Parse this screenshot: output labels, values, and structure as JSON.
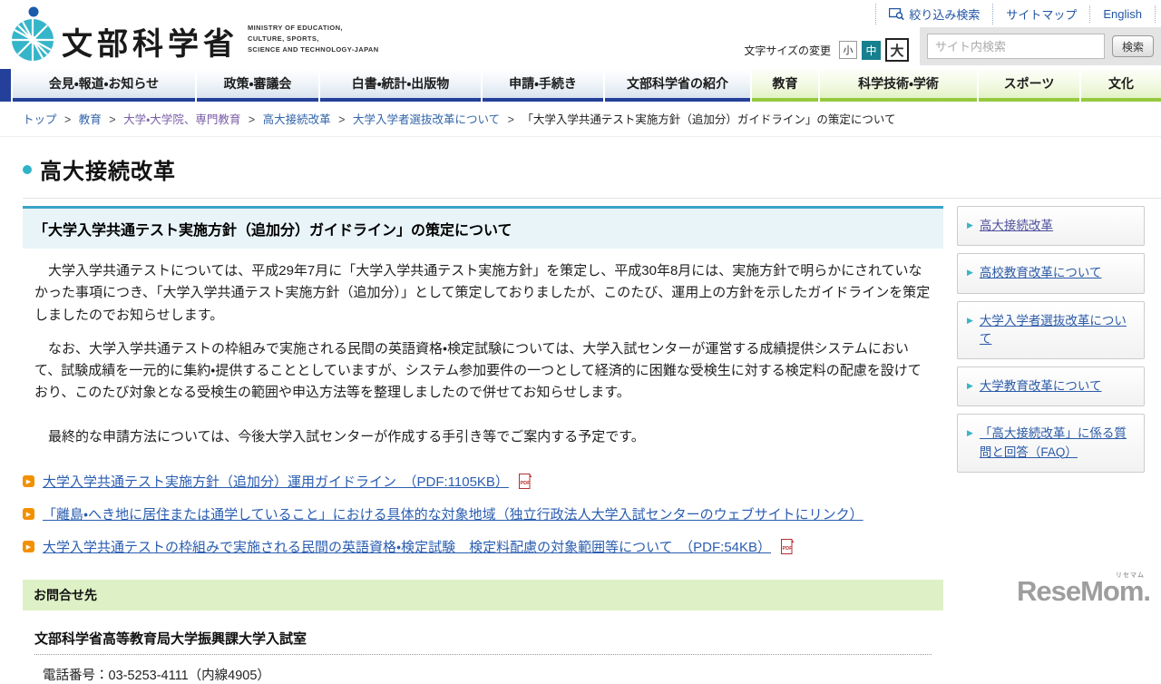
{
  "header": {
    "logo": {
      "title": "文部科学省",
      "subtitle_lines": [
        "MINISTRY OF EDUCATION,",
        "CULTURE, SPORTS,",
        "SCIENCE AND TECHNOLOGY-JAPAN"
      ]
    },
    "utility_links": [
      {
        "label": "絞り込み検索",
        "icon": "filter-search-icon"
      },
      {
        "label": "サイトマップ"
      },
      {
        "label": "English"
      }
    ],
    "font_size": {
      "label": "文字サイズの変更",
      "options": [
        {
          "label": "小",
          "selected": false
        },
        {
          "label": "中",
          "selected": true
        },
        {
          "label": "大",
          "selected": false
        }
      ]
    },
    "search": {
      "placeholder": "サイト内検索",
      "button_label": "検索"
    }
  },
  "nav": {
    "items": [
      {
        "label": "会見・報道・お知らせ",
        "theme": "blue"
      },
      {
        "label": "政策・審議会",
        "theme": "blue"
      },
      {
        "label": "白書・統計・出版物",
        "theme": "blue"
      },
      {
        "label": "申請・手続き",
        "theme": "blue"
      },
      {
        "label": "文部科学省の紹介",
        "theme": "blue"
      },
      {
        "label": "教育",
        "theme": "green"
      },
      {
        "label": "科学技術・学術",
        "theme": "green"
      },
      {
        "label": "スポーツ",
        "theme": "green"
      },
      {
        "label": "文化",
        "theme": "green"
      }
    ]
  },
  "breadcrumb": {
    "separator": ">",
    "items": [
      {
        "label": "トップ",
        "type": "link"
      },
      {
        "label": "教育",
        "type": "link"
      },
      {
        "label": "大学・大学院、専門教育",
        "type": "visited"
      },
      {
        "label": "高大接続改革",
        "type": "link"
      },
      {
        "label": "大学入学者選抜改革について",
        "type": "link"
      },
      {
        "label": "「大学入学共通テスト実施方針（追加分）ガイドライン」の策定について",
        "type": "current"
      }
    ]
  },
  "page": {
    "section_title": "高大接続改革"
  },
  "main": {
    "article_title": "「大学入学共通テスト実施方針（追加分）ガイドライン」の策定について",
    "paragraphs": [
      "　大学入学共通テストについては、平成29年7月に「大学入学共通テスト実施方針」を策定し、平成30年8月には、実施方針で明らかにされていなかった事項につき、「大学入学共通テスト実施方針（追加分）」として策定しておりましたが、このたび、運用上の方針を示したガイドラインを策定しましたのでお知らせします。",
      "　なお、大学入学共通テストの枠組みで実施される民間の英語資格・検定試験については、大学入試センターが運営する成績提供システムにおいて、試験成績を一元的に集約・提供することとしていますが、システム参加要件の一つとして経済的に困難な受検生に対する検定料の配慮を設けており、このたび対象となる受検生の範囲や申込方法等を整理しましたので併せてお知らせします。",
      "　最終的な申請方法については、今後大学入試センターが作成する手引き等でご案内する予定です。"
    ],
    "links": [
      {
        "label": "大学入学共通テスト実施方針（追加分）運用ガイドライン　（PDF:1105KB）",
        "pdf": true
      },
      {
        "label": "「離島・へき地に居住または通学していること」における具体的な対象地域（独立行政法人大学入試センターのウェブサイトにリンク）",
        "pdf": false
      },
      {
        "label": "大学入学共通テストの枠組みで実施される民間の英語資格・検定試験　検定料配慮の対象範囲等について　（PDF:54KB）",
        "pdf": true
      }
    ],
    "contact": {
      "heading": "お問合せ先",
      "department": "文部科学省高等教育局大学振興課大学入試室",
      "phone": "電話番号：03-5253-4111（内線4905）"
    }
  },
  "sidebar": {
    "items": [
      {
        "label": "高大接続改革",
        "visited": true
      },
      {
        "label": "高校教育改革について",
        "visited": false
      },
      {
        "label": "大学入学者選抜改革について",
        "visited": false
      },
      {
        "label": "大学教育改革について",
        "visited": false
      },
      {
        "label": "「高大接続改革」に係る質問と回答（FAQ）",
        "visited": false
      }
    ]
  },
  "icons": {
    "arrow_right": "▶"
  },
  "watermark": {
    "text": "ReseMom.",
    "ruby": "リセマム"
  },
  "colors": {
    "nav_blue": "#24409a",
    "nav_green": "#96c93f",
    "accent_teal": "#39a3c5",
    "bullet_orange": "#f39000",
    "link_blue": "#2a5db0",
    "contact_green": "#def1c6",
    "selected_fontsize_teal": "#17808f"
  }
}
